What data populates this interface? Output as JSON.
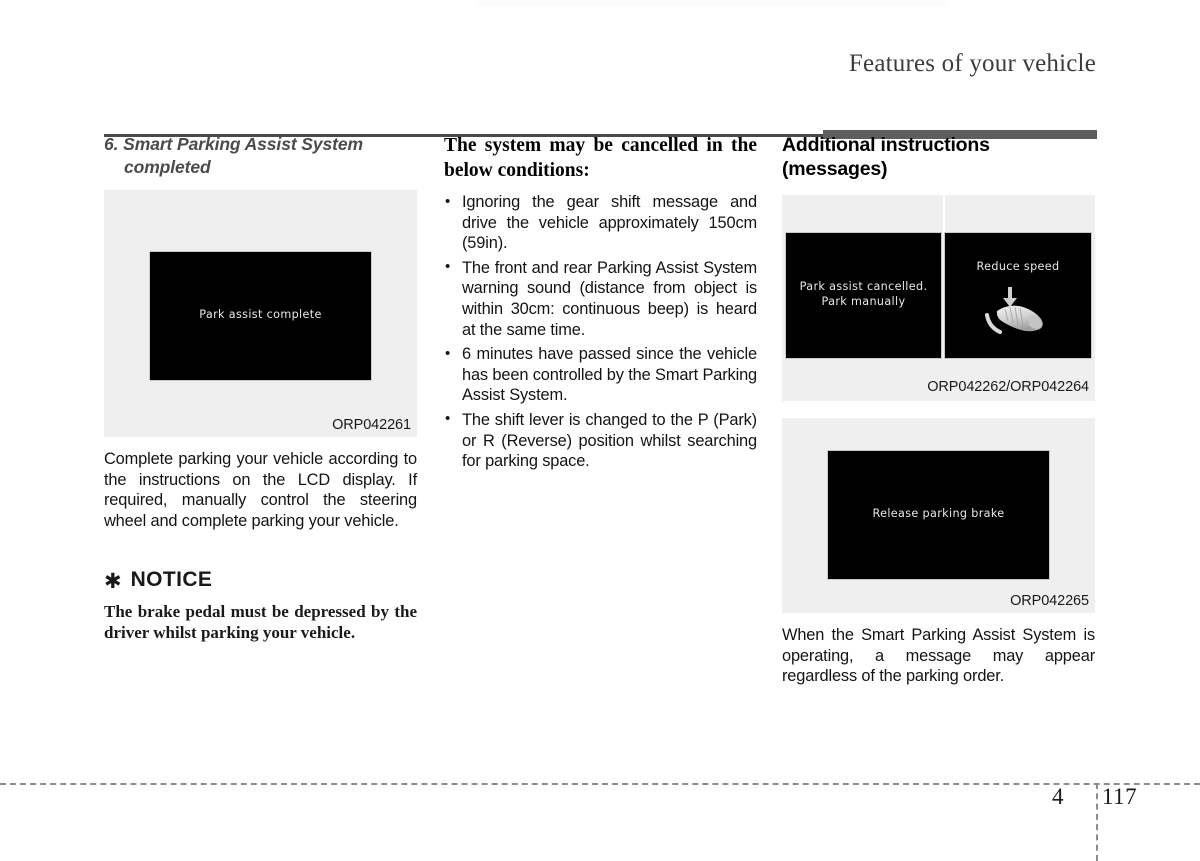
{
  "page": {
    "header_title": "Features of your vehicle",
    "chapter_number": "4",
    "page_number": "117"
  },
  "left_column": {
    "heading_line1": "6. Smart Parking Assist System",
    "heading_line2": "completed",
    "figure": {
      "lcd_message": "Park assist complete",
      "caption": "ORP042261"
    },
    "body": "Complete parking your vehicle according to the instructions on the LCD display. If required, manually control the steering wheel and complete parking your vehicle.",
    "notice": {
      "star_glyph": "✱",
      "label": "NOTICE",
      "body": "The brake pedal must be depressed by the driver whilst parking your vehicle."
    }
  },
  "middle_column": {
    "heading": "The system may be cancelled in the below conditions:",
    "bullets": [
      "Ignoring the gear shift message and drive the vehicle approximately 150cm (59in).",
      "The front and rear Parking Assist System warning sound (distance from object is within 30cm: continuous beep) is heard at the same time.",
      "6 minutes have passed since the vehicle has been controlled by the Smart Parking Assist System.",
      "The shift lever is changed to the P (Park) or R (Reverse) position whilst searching for parking space."
    ]
  },
  "right_column": {
    "heading_line1": "Additional instructions",
    "heading_line2": "(messages)",
    "figure_pair": {
      "lcd_left_message": "Park assist cancelled.\nPark manually",
      "lcd_right_message": "Reduce speed",
      "lcd_right_icon": "foot-pedal-icon",
      "caption": "ORP042262/ORP042264"
    },
    "figure_single": {
      "lcd_message": "Release parking brake",
      "caption": "ORP042265"
    },
    "body": "When the Smart Parking Assist System is operating, a message may appear regardless of the parking order."
  },
  "colors": {
    "header_text": "#3d3d3d",
    "header_rule": "#5d5d5d",
    "figure_background": "#efefef",
    "lcd_background": "#000000",
    "lcd_text": "#e8e8e8",
    "heading_italic": "#4b4b4b"
  }
}
